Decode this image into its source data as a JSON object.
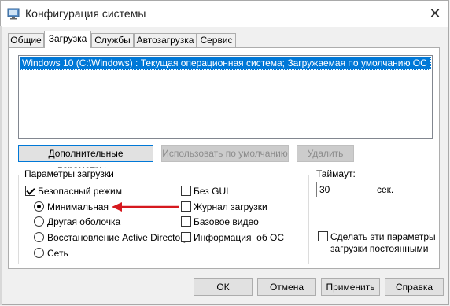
{
  "window": {
    "title": "Конфигурация системы",
    "close_glyph": "✕"
  },
  "tabs": [
    {
      "label": "Общие"
    },
    {
      "label": "Загрузка",
      "active": true
    },
    {
      "label": "Службы"
    },
    {
      "label": "Автозагрузка"
    },
    {
      "label": "Сервис"
    }
  ],
  "os_list": {
    "items": [
      {
        "label": "Windows 10 (C:\\Windows) : Текущая операционная система; Загружаемая по умолчанию ОС",
        "selected": true
      }
    ]
  },
  "boot_buttons": {
    "advanced": "Дополнительные параметры...",
    "set_default": "Использовать по умолчанию",
    "delete": "Удалить"
  },
  "boot_options": {
    "title": "Параметры загрузки",
    "safe_boot": {
      "label": "Безопасный режим",
      "checked": true
    },
    "minimal": {
      "label": "Минимальная",
      "checked": true
    },
    "alternate_shell": {
      "label": "Другая оболочка",
      "checked": false
    },
    "ad_repair": {
      "label": "Восстановление Active Directory",
      "checked": false
    },
    "network": {
      "label": "Сеть",
      "checked": false
    },
    "no_gui": {
      "label": "Без GUI",
      "checked": false
    },
    "boot_log": {
      "label": "Журнал загрузки",
      "checked": false
    },
    "base_video": {
      "label": "Базовое видео",
      "checked": false
    },
    "os_info": {
      "label": "Информация  об ОС",
      "checked": false
    }
  },
  "timeout": {
    "label": "Таймаут:",
    "value": "30",
    "unit": "сек."
  },
  "make_permanent": {
    "label_line1": "Сделать эти параметры",
    "label_line2": "загрузки постоянными",
    "checked": false
  },
  "dialog_buttons": {
    "ok": "ОК",
    "cancel": "Отмена",
    "apply": "Применить",
    "help": "Справка"
  },
  "annotation": {
    "arrow_color": "#d6181e"
  },
  "colors": {
    "selection": "#0078d7"
  }
}
